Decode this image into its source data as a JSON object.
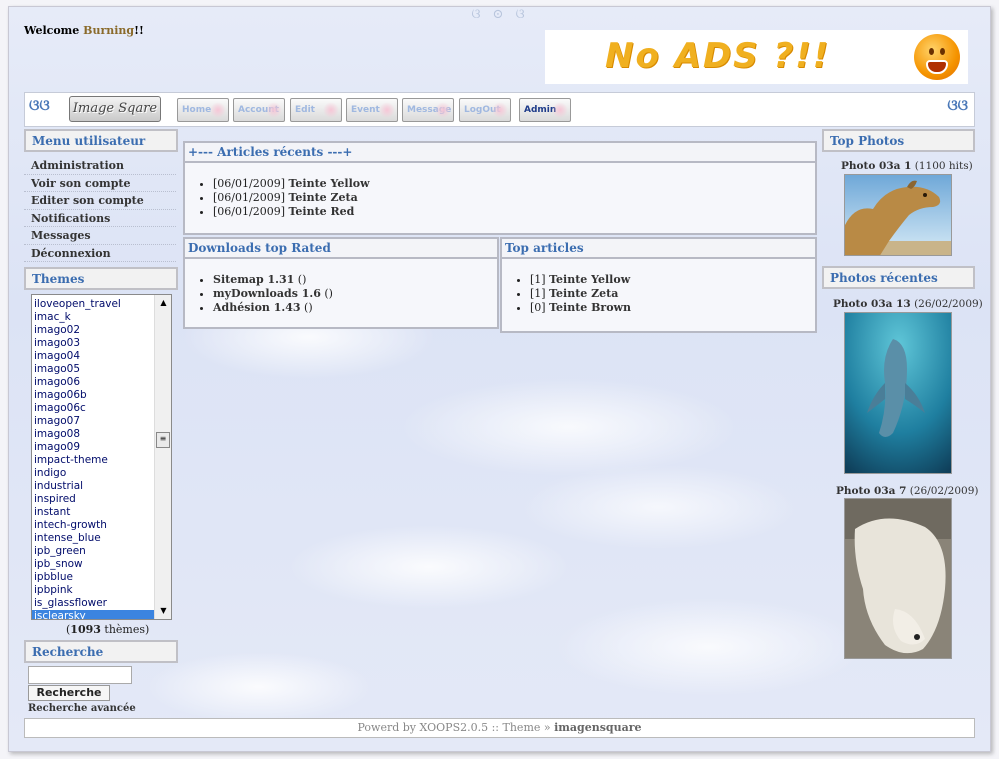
{
  "header": {
    "welcome_prefix": "Welcome",
    "username": "Burning",
    "welcome_suffix": "!!",
    "banner_text": "No ADS ?!!"
  },
  "nav": {
    "logo": "Image Sqare",
    "buttons": [
      "Home",
      "Account",
      "Edit",
      "Event",
      "Message",
      "LogOut",
      "Admin"
    ]
  },
  "user_menu": {
    "title": "Menu utilisateur",
    "items": [
      "Administration",
      "Voir son compte",
      "Editer son compte",
      "Notifications",
      "Messages",
      "Déconnexion"
    ]
  },
  "themes": {
    "title": "Themes",
    "options": [
      "iloveopen_travel",
      "imac_k",
      "imago02",
      "imago03",
      "imago04",
      "imago05",
      "imago06",
      "imago06b",
      "imago06c",
      "imago07",
      "imago08",
      "imago09",
      "impact-theme",
      "indigo",
      "industrial",
      "inspired",
      "instant",
      "intech-growth",
      "intense_blue",
      "ipb_green",
      "ipb_snow",
      "ipbblue",
      "ipbpink",
      "is_glassflower",
      "isclearsky"
    ],
    "selected": "isclearsky",
    "count_open": "(",
    "count": "1093",
    "count_suffix": " thèmes)"
  },
  "search": {
    "title": "Recherche",
    "button": "Recherche",
    "advanced": "Recherche avancée"
  },
  "recent_articles": {
    "title": "+--- Articles récents ---+",
    "items": [
      {
        "date": "[06/01/2009]",
        "title": "Teinte Yellow"
      },
      {
        "date": "[06/01/2009]",
        "title": "Teinte Zeta"
      },
      {
        "date": "[06/01/2009]",
        "title": "Teinte Red"
      }
    ]
  },
  "downloads": {
    "title": "Downloads top Rated",
    "items": [
      {
        "title": "Sitemap 1.31",
        "extra": " ()"
      },
      {
        "title": "myDownloads 1.6",
        "extra": " ()"
      },
      {
        "title": "Adhésion 1.43",
        "extra": " ()"
      }
    ]
  },
  "top_articles": {
    "title": "Top articles",
    "items": [
      {
        "rank": "[1]",
        "title": "Teinte Yellow"
      },
      {
        "rank": "[1]",
        "title": "Teinte Zeta"
      },
      {
        "rank": "[0]",
        "title": "Teinte Brown"
      }
    ]
  },
  "top_photos": {
    "title": "Top Photos",
    "items": [
      {
        "name": "Photo 03a 1",
        "meta": " (1100 hits)"
      }
    ]
  },
  "recent_photos": {
    "title": "Photos récentes",
    "items": [
      {
        "name": "Photo 03a 13",
        "meta": " (26/02/2009)"
      },
      {
        "name": "Photo 03a 7",
        "meta": " (26/02/2009)"
      }
    ]
  },
  "footer": {
    "text": "Powerd by XOOPS2.0.5 :: Theme » ",
    "theme": "imagensquare"
  }
}
